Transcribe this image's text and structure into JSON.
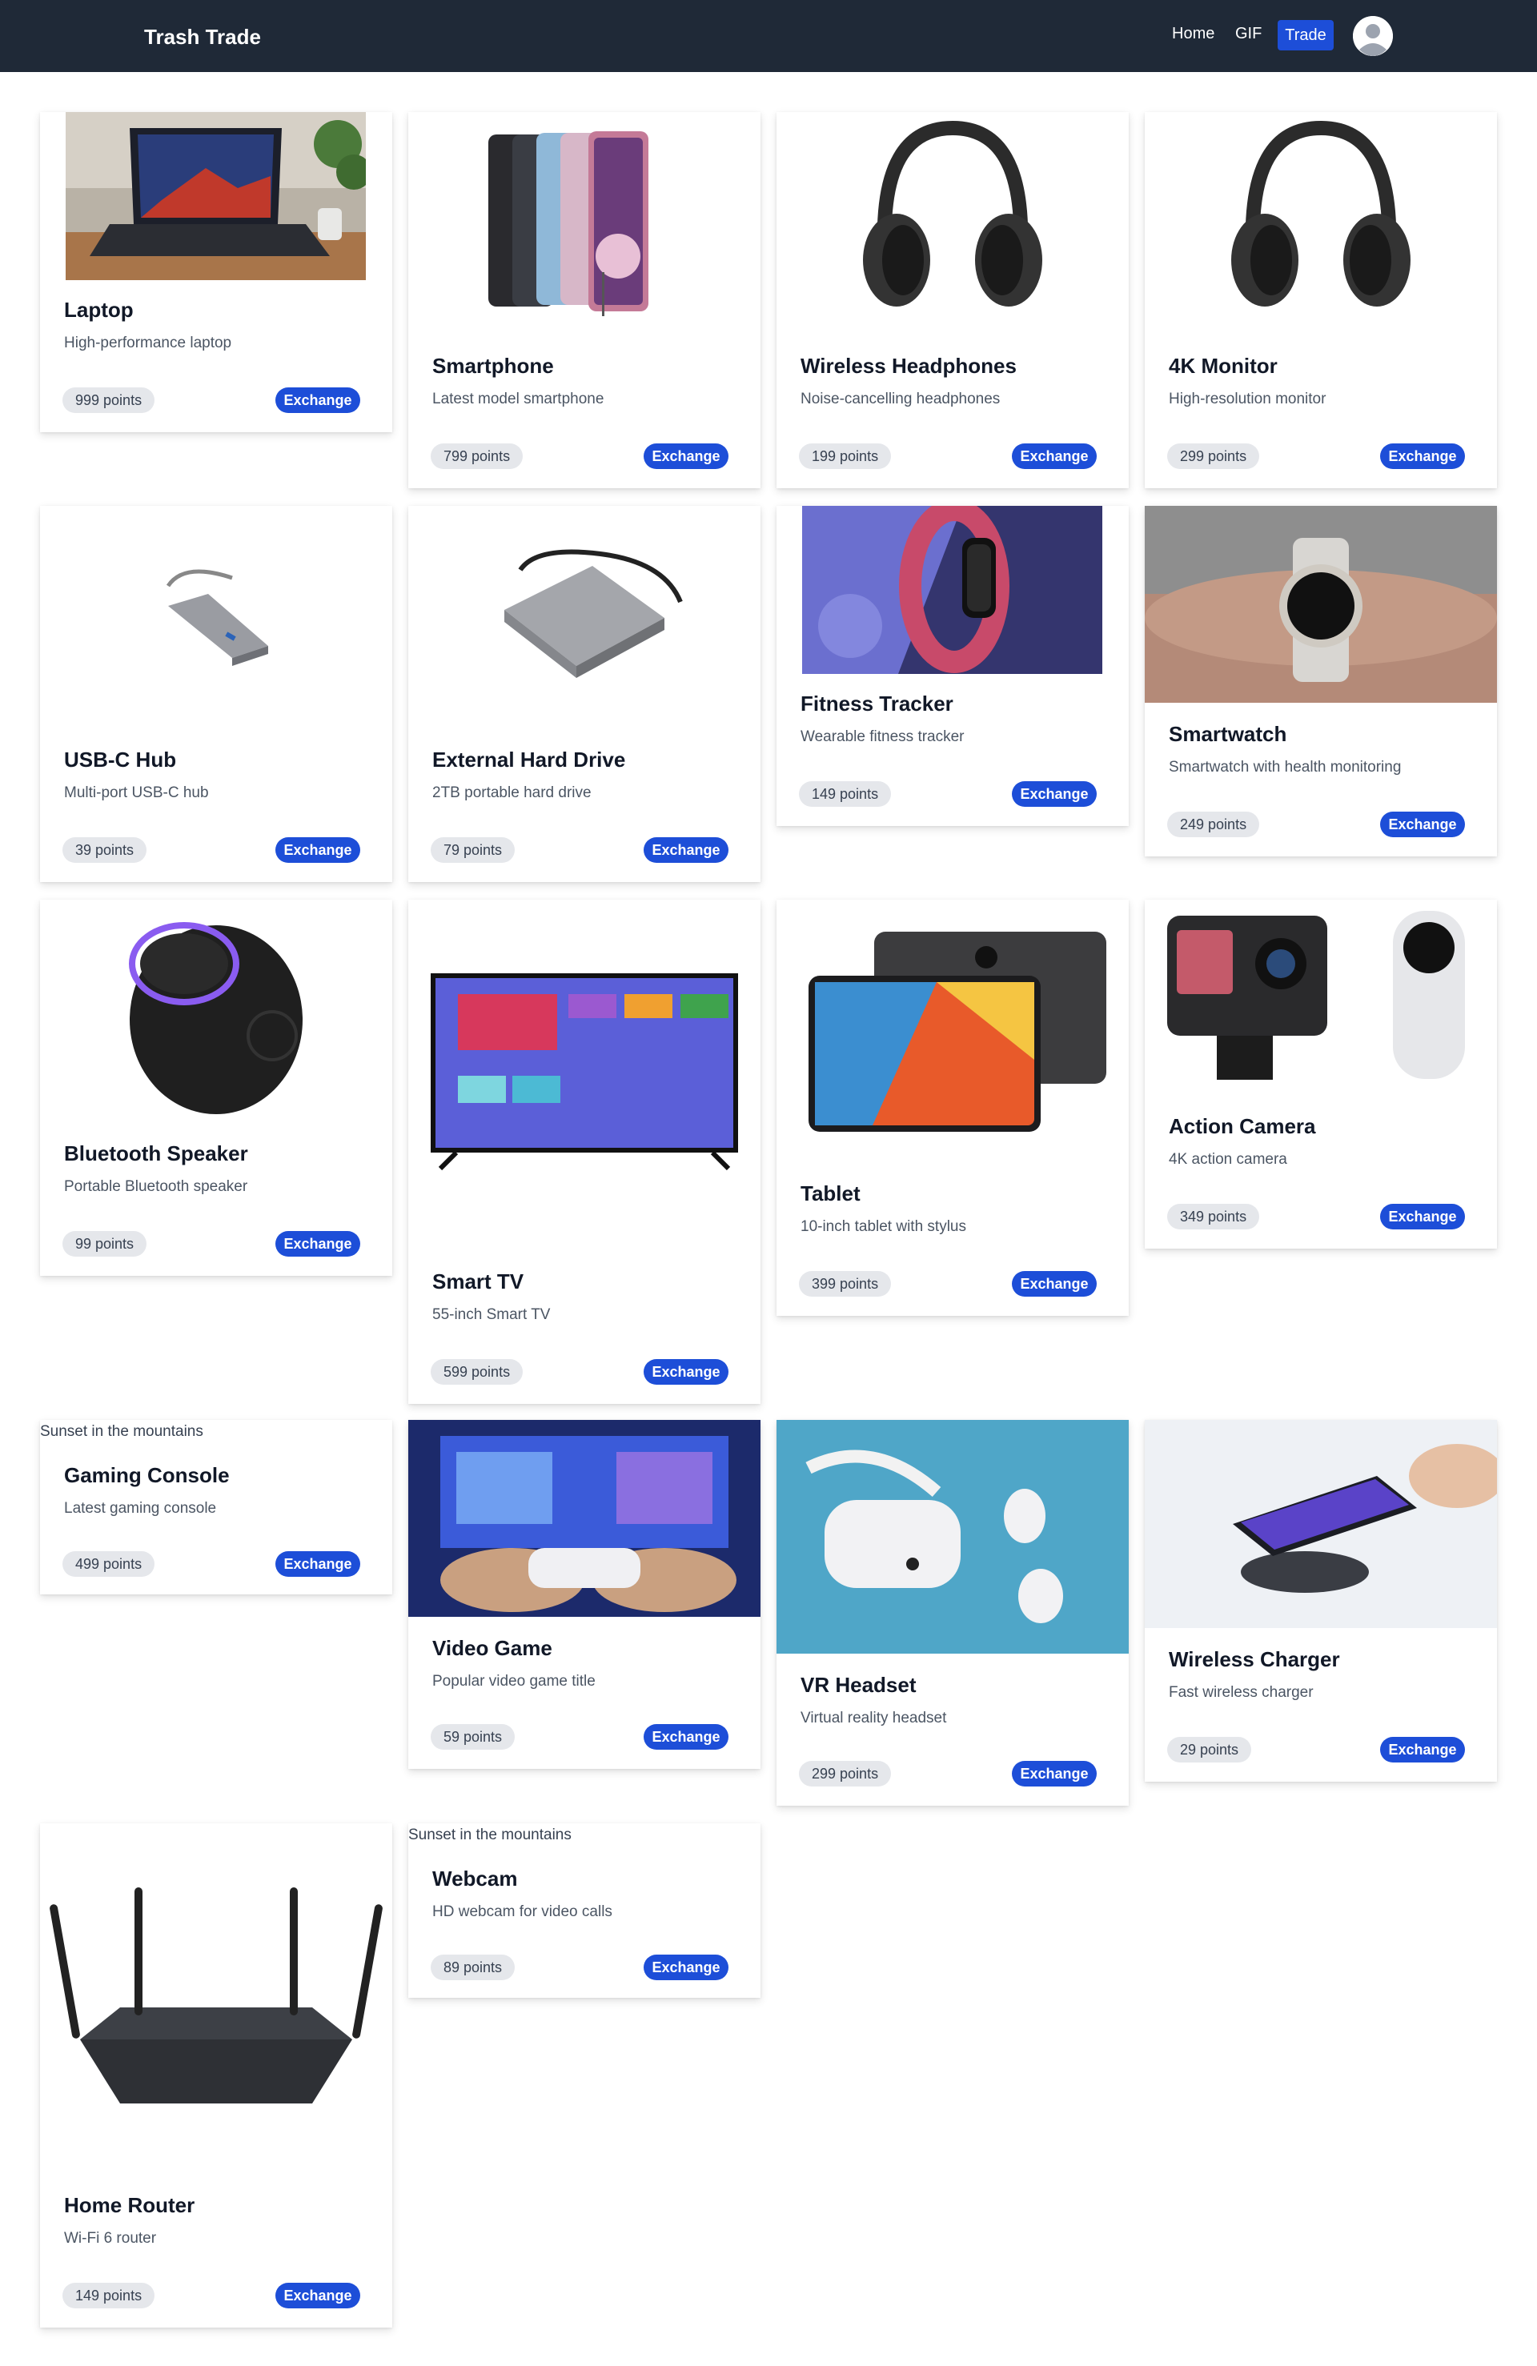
{
  "nav": {
    "brand": "Trash Trade",
    "home": "Home",
    "gif": "GIF",
    "trade": "Trade"
  },
  "broken_image_alt": "Sunset in the mountains",
  "exchange_label": "Exchange",
  "items": [
    {
      "title": "Laptop",
      "desc": "High-performance laptop",
      "points": "999 points"
    },
    {
      "title": "Smartphone",
      "desc": "Latest model smartphone",
      "points": "799 points"
    },
    {
      "title": "Wireless Headphones",
      "desc": "Noise-cancelling headphones",
      "points": "199 points"
    },
    {
      "title": "4K Monitor",
      "desc": "High-resolution monitor",
      "points": "299 points"
    },
    {
      "title": "USB-C Hub",
      "desc": "Multi-port USB-C hub",
      "points": "39 points"
    },
    {
      "title": "External Hard Drive",
      "desc": "2TB portable hard drive",
      "points": "79 points"
    },
    {
      "title": "Fitness Tracker",
      "desc": "Wearable fitness tracker",
      "points": "149 points"
    },
    {
      "title": "Smartwatch",
      "desc": "Smartwatch with health monitoring",
      "points": "249 points"
    },
    {
      "title": "Bluetooth Speaker",
      "desc": "Portable Bluetooth speaker",
      "points": "99 points"
    },
    {
      "title": "Smart TV",
      "desc": "55-inch Smart TV",
      "points": "599 points"
    },
    {
      "title": "Tablet",
      "desc": "10-inch tablet with stylus",
      "points": "399 points"
    },
    {
      "title": "Action Camera",
      "desc": "4K action camera",
      "points": "349 points"
    },
    {
      "title": "Gaming Console",
      "desc": "Latest gaming console",
      "points": "499 points"
    },
    {
      "title": "Video Game",
      "desc": "Popular video game title",
      "points": "59 points"
    },
    {
      "title": "VR Headset",
      "desc": "Virtual reality headset",
      "points": "299 points"
    },
    {
      "title": "Wireless Charger",
      "desc": "Fast wireless charger",
      "points": "29 points"
    },
    {
      "title": "Home Router",
      "desc": "Wi-Fi 6 router",
      "points": "149 points"
    },
    {
      "title": "Webcam",
      "desc": "HD webcam for video calls",
      "points": "89 points"
    }
  ]
}
